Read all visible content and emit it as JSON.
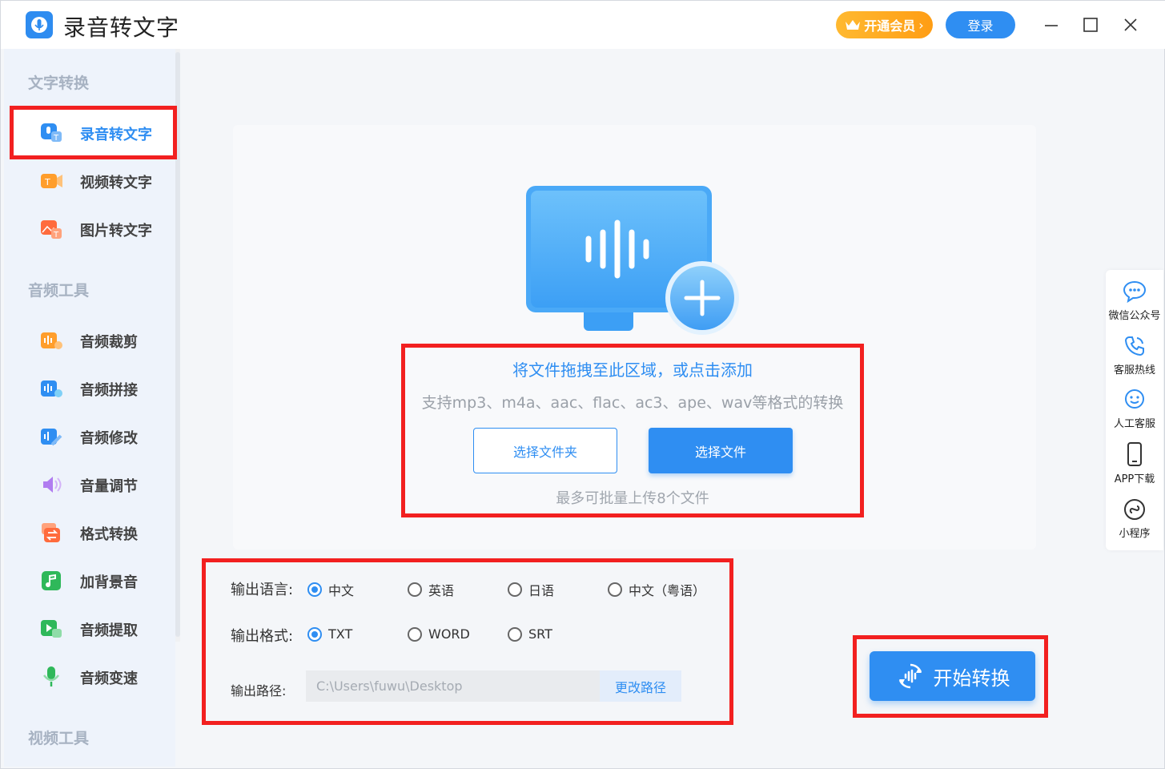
{
  "app": {
    "title": "录音转文字",
    "vip_label": "开通会员",
    "login_label": "登录"
  },
  "sidebar": {
    "section_text": "文字转换",
    "text_items": [
      {
        "label": "录音转文字",
        "icon": "audio-to-text-icon"
      },
      {
        "label": "视频转文字",
        "icon": "video-to-text-icon"
      },
      {
        "label": "图片转文字",
        "icon": "image-to-text-icon"
      }
    ],
    "section_audio": "音频工具",
    "audio_items": [
      {
        "label": "音频裁剪",
        "icon": "audio-cut-icon"
      },
      {
        "label": "音频拼接",
        "icon": "audio-merge-icon"
      },
      {
        "label": "音频修改",
        "icon": "audio-edit-icon"
      },
      {
        "label": "音量调节",
        "icon": "volume-icon"
      },
      {
        "label": "格式转换",
        "icon": "format-convert-icon"
      },
      {
        "label": "加背景音",
        "icon": "music-icon"
      },
      {
        "label": "音频提取",
        "icon": "audio-extract-icon"
      },
      {
        "label": "音频变速",
        "icon": "microphone-icon"
      }
    ],
    "section_video": "视频工具"
  },
  "upload": {
    "main_text": "将文件拖拽至此区域，或点击添加",
    "formats_text": "支持mp3、m4a、aac、flac、ac3、ape、wav等格式的转换",
    "folder_button": "选择文件夹",
    "file_button": "选择文件",
    "limit_text": "最多可批量上传8个文件"
  },
  "options": {
    "language_label": "输出语言:",
    "languages": [
      "中文",
      "英语",
      "日语",
      "中文（粤语）"
    ],
    "language_selected": "中文",
    "format_label": "输出格式:",
    "formats": [
      "TXT",
      "WORD",
      "SRT"
    ],
    "format_selected": "TXT",
    "path_label": "输出路径:",
    "path_value": "C:\\Users\\fuwu\\Desktop",
    "change_path": "更改路径"
  },
  "start_button": "开始转换",
  "float_panel": [
    {
      "label": "微信公众号",
      "icon": "wechat-icon"
    },
    {
      "label": "客服热线",
      "icon": "phone-icon"
    },
    {
      "label": "人工客服",
      "icon": "service-icon"
    },
    {
      "label": "APP下载",
      "icon": "mobile-icon"
    },
    {
      "label": "小程序",
      "icon": "mini-program-icon"
    }
  ],
  "colors": {
    "accent": "#2f8ef2",
    "vip": "#ffa820",
    "highlight": "#f22020"
  }
}
